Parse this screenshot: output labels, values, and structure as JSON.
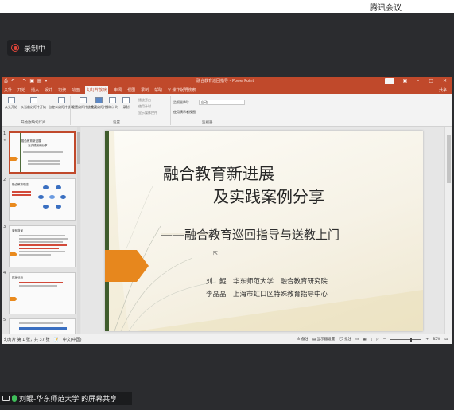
{
  "meeting": {
    "title": "腾讯会议",
    "recording_label": "录制中",
    "share_label": "刘鲲-华东师范大学 的屏幕共享",
    "bg_color": "#2b2c2f"
  },
  "ppt": {
    "window_title": "融合教育巡回指导 - PowerPoint",
    "accent_color": "#c0492b",
    "quick_access": "⎙ ↶ · ↷ ▣ ▤ ▾",
    "login_label": "登录",
    "tabs": [
      "文件",
      "开始",
      "插入",
      "设计",
      "切换",
      "动画",
      "幻灯片放映",
      "审阅",
      "视图",
      "录制",
      "帮助",
      "♀ 操作说明搜索"
    ],
    "active_tab": "幻灯片放映",
    "share_label": "共享",
    "ribbon": {
      "btn_from_start": "从头开始",
      "btn_from_current": "从当前幻灯片开始",
      "btn_custom": "自定义幻灯片放映",
      "btn_setup": "设置幻灯片放映",
      "btn_hide": "隐藏幻灯片",
      "btn_rehearse": "排练计时",
      "btn_record": "录制",
      "chk_narration": "播放旁白",
      "chk_timings": "使用计时",
      "chk_media": "显示媒体控件",
      "monitor_label": "监视器(M):",
      "monitor_value": "自动",
      "presenter_view": "使用演示者视图",
      "group_start": "开始放映幻灯片",
      "group_setup": "设置",
      "group_monitor": "监视器"
    },
    "thumbnails": [
      {
        "num": "1",
        "title": "融合教育新进展",
        "subtitle": "及实践案例分享"
      },
      {
        "num": "2",
        "title": "融合教育理念",
        "subtitle": "六大基本要素"
      },
      {
        "num": "3",
        "title": "案例背景",
        "subtitle": ""
      },
      {
        "num": "4",
        "title": "现状分析",
        "subtitle": ""
      },
      {
        "num": "5",
        "title": "",
        "subtitle": ""
      }
    ],
    "slide": {
      "title_line1": "融合教育新进展",
      "title_line2": "及实践案例分享",
      "subtitle": "——融合教育巡回指导与送教上门",
      "author_line1": "刘　鲲　华东师范大学　融合教育研究院",
      "author_line2": "李晶晶　上海市虹口区特殊教育指导中心"
    },
    "status": {
      "slide_info": "幻灯片 第 1 张，共 37 张　📝　中文(中国)",
      "notes": "≙ 备注",
      "comments": "💬 批注",
      "display": "▤ 显示器设置",
      "zoom": "85%"
    }
  }
}
